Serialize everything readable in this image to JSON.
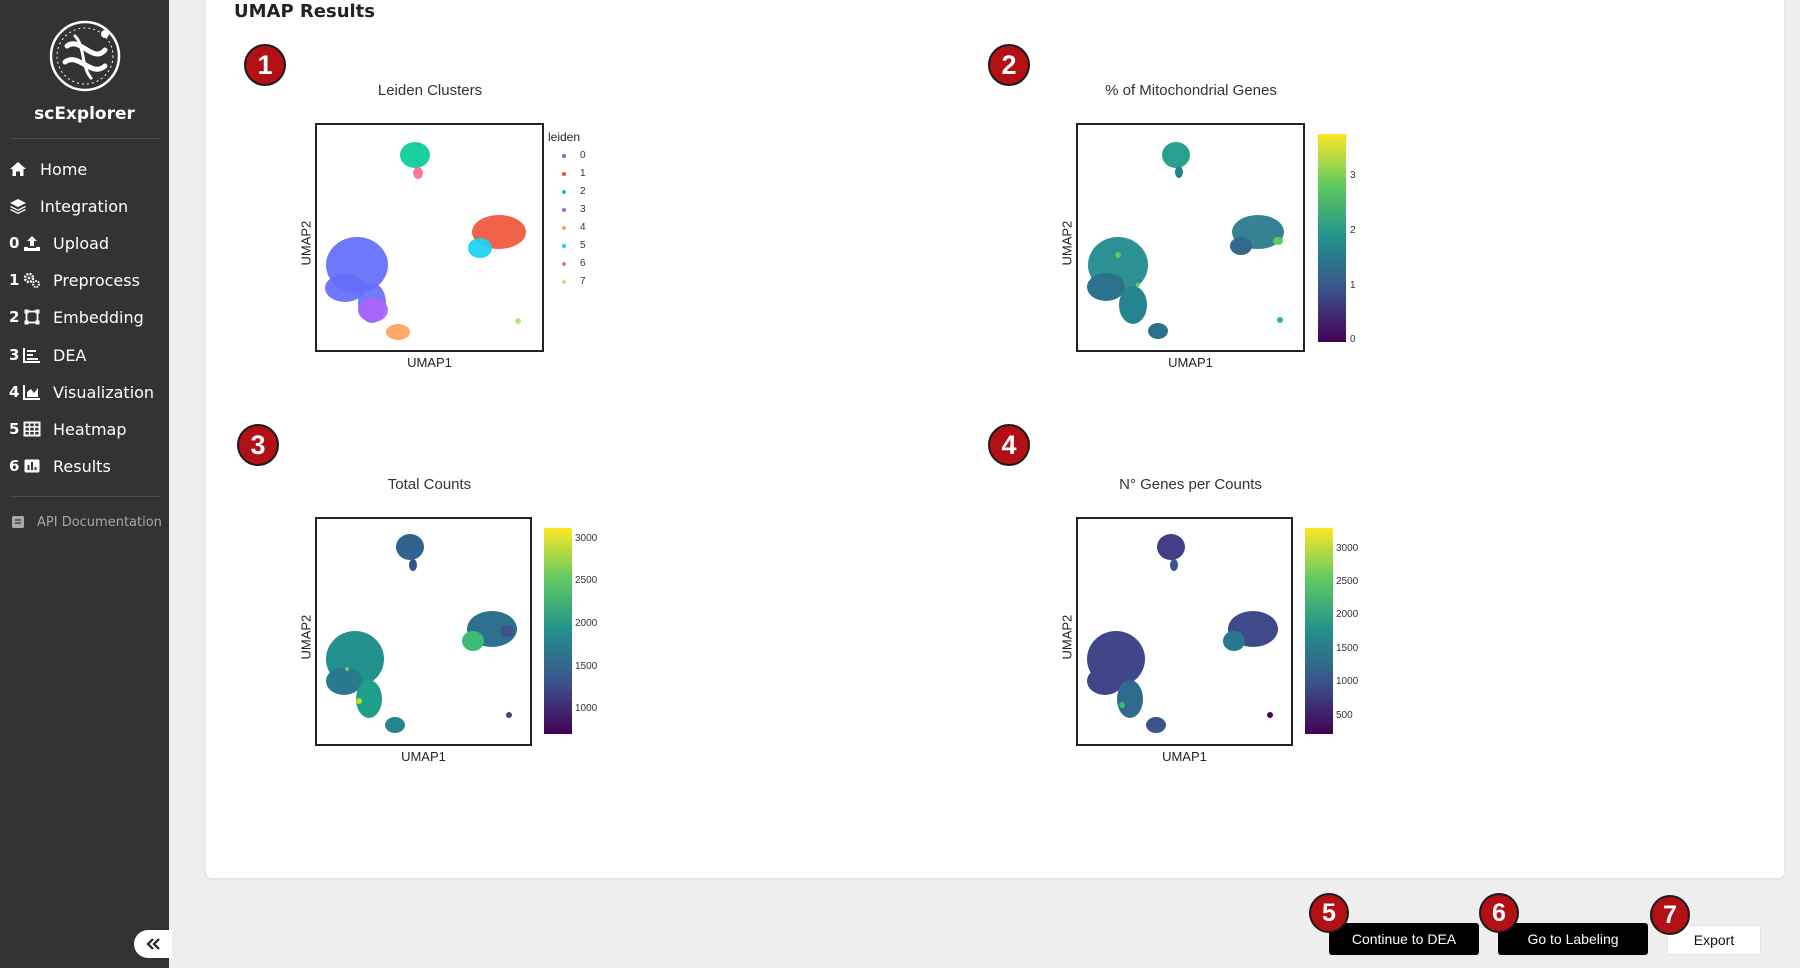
{
  "sidebar": {
    "brand": "scExplorer",
    "items": [
      {
        "num": "",
        "label": "Home",
        "icon": "home-icon"
      },
      {
        "num": "",
        "label": "Integration",
        "icon": "layers-icon"
      },
      {
        "num": "0",
        "label": "Upload",
        "icon": "upload-icon"
      },
      {
        "num": "1",
        "label": "Preprocess",
        "icon": "gears-icon"
      },
      {
        "num": "2",
        "label": "Embedding",
        "icon": "vector-square-icon"
      },
      {
        "num": "3",
        "label": "DEA",
        "icon": "bar-chart-icon"
      },
      {
        "num": "4",
        "label": "Visualization",
        "icon": "area-chart-icon"
      },
      {
        "num": "5",
        "label": "Heatmap",
        "icon": "table-icon"
      },
      {
        "num": "6",
        "label": "Results",
        "icon": "results-icon"
      }
    ],
    "api_label": "API Documentation",
    "collapse_icon": "double-chevron-left-icon"
  },
  "main": {
    "title": "UMAP Results",
    "plots": [
      {
        "badge": "1",
        "title": "Leiden Clusters",
        "xlabel": "UMAP1",
        "ylabel": "UMAP2",
        "legend_title": "leiden",
        "legend": [
          {
            "label": "0",
            "color": "#636efa"
          },
          {
            "label": "1",
            "color": "#ef553b"
          },
          {
            "label": "2",
            "color": "#00cc96"
          },
          {
            "label": "3",
            "color": "#ab63fa"
          },
          {
            "label": "4",
            "color": "#ffa15a"
          },
          {
            "label": "5",
            "color": "#19d3f3"
          },
          {
            "label": "6",
            "color": "#ff6692"
          },
          {
            "label": "7",
            "color": "#b6e880"
          }
        ]
      },
      {
        "badge": "2",
        "title": "% of Mitochondrial Genes",
        "xlabel": "UMAP1",
        "ylabel": "UMAP2",
        "colorbar_ticks": [
          "3",
          "2",
          "1",
          "0"
        ]
      },
      {
        "badge": "3",
        "title": "Total Counts",
        "xlabel": "UMAP1",
        "ylabel": "UMAP2",
        "colorbar_ticks": [
          "3000",
          "2500",
          "2000",
          "1500",
          "1000"
        ]
      },
      {
        "badge": "4",
        "title": "N° Genes per Counts",
        "xlabel": "UMAP1",
        "ylabel": "UMAP2",
        "colorbar_ticks": [
          "3000",
          "2500",
          "2000",
          "1500",
          "1000",
          "500"
        ]
      }
    ]
  },
  "actions": {
    "continue_badge": "5",
    "continue_label": "Continue to DEA",
    "labeling_badge": "6",
    "labeling_label": "Go to Labeling",
    "export_badge": "7",
    "export_label": "Export"
  }
}
